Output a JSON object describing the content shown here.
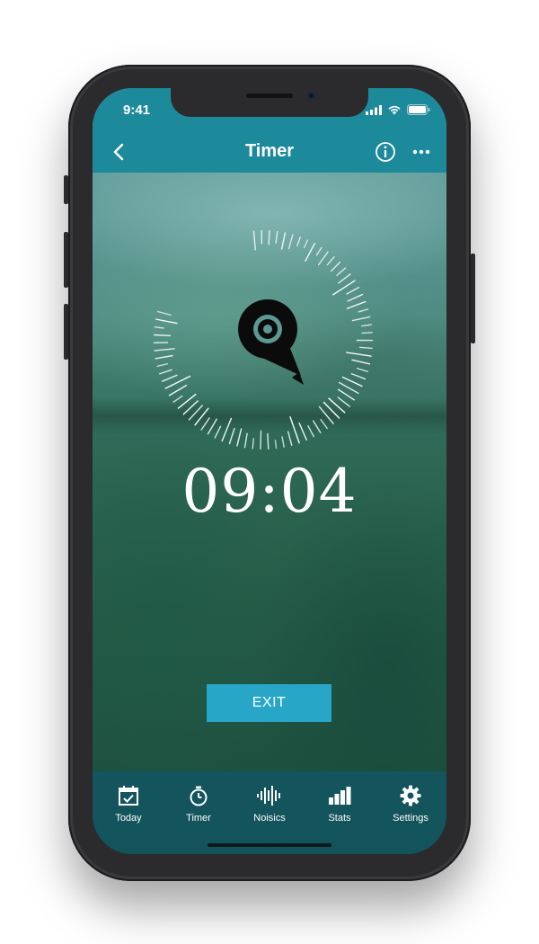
{
  "status_bar": {
    "time": "9:41"
  },
  "nav": {
    "back_icon": "chevron-left-icon",
    "title": "Timer",
    "info_icon": "info-icon",
    "more_icon": "more-dots-icon"
  },
  "timer": {
    "display": "09:04",
    "indicator_icon": "location-pin-icon"
  },
  "actions": {
    "exit_label": "EXIT"
  },
  "tab_bar": {
    "items": [
      {
        "label": "Today",
        "icon": "calendar-icon"
      },
      {
        "label": "Timer",
        "icon": "stopwatch-icon"
      },
      {
        "label": "Noisics",
        "icon": "soundwave-icon"
      },
      {
        "label": "Stats",
        "icon": "bar-chart-icon"
      },
      {
        "label": "Settings",
        "icon": "gear-icon"
      }
    ]
  },
  "colors": {
    "header": "#1d8a9b",
    "exit_button": "#27a6c8",
    "tab_bar": "#12555f",
    "text": "#ffffff"
  }
}
